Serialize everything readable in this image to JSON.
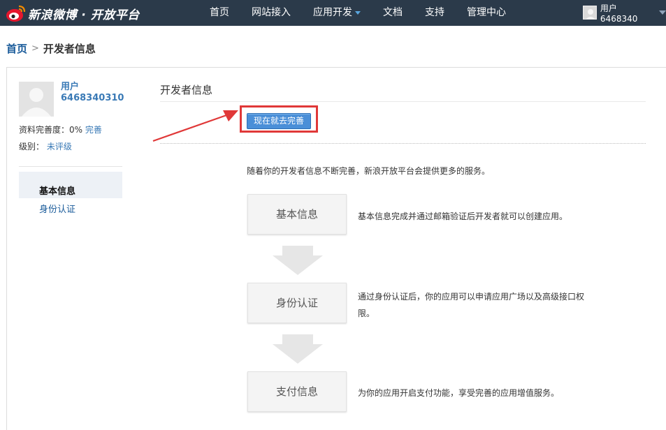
{
  "topbar": {
    "logo_text": "新浪微博 · 开放平台",
    "nav": [
      "首页",
      "网站接入",
      "应用开发",
      "文档",
      "支持",
      "管理中心"
    ],
    "user_name": "用户6468340"
  },
  "breadcrumb": {
    "home": "首页",
    "separator": ">",
    "current": "开发者信息"
  },
  "sidebar": {
    "user_name_line1": "用户",
    "user_name_line2": "6468340310",
    "completeness_label": "资料完善度：0%",
    "completeness_link": "完善",
    "level_label": "级别：",
    "level_link": "未评级",
    "items": [
      "基本信息",
      "身份认证"
    ]
  },
  "main": {
    "title": "开发者信息",
    "now_button": "现在就去完善",
    "intro": "随着你的开发者信息不断完善，新浪开放平台会提供更多的服务。",
    "steps": [
      {
        "label": "基本信息",
        "desc": "基本信息完成并通过邮箱验证后开发者就可以创建应用。"
      },
      {
        "label": "身份认证",
        "desc": "通过身份认证后，你的应用可以申请应用广场以及高级接口权限。"
      },
      {
        "label": "支付信息",
        "desc": "为你的应用开启支付功能，享受完善的应用增值服务。"
      }
    ]
  },
  "colors": {
    "topbar": "#2b3a4a",
    "link": "#3a7ab6",
    "button": "#4a8fd8",
    "highlight": "#e03838"
  }
}
